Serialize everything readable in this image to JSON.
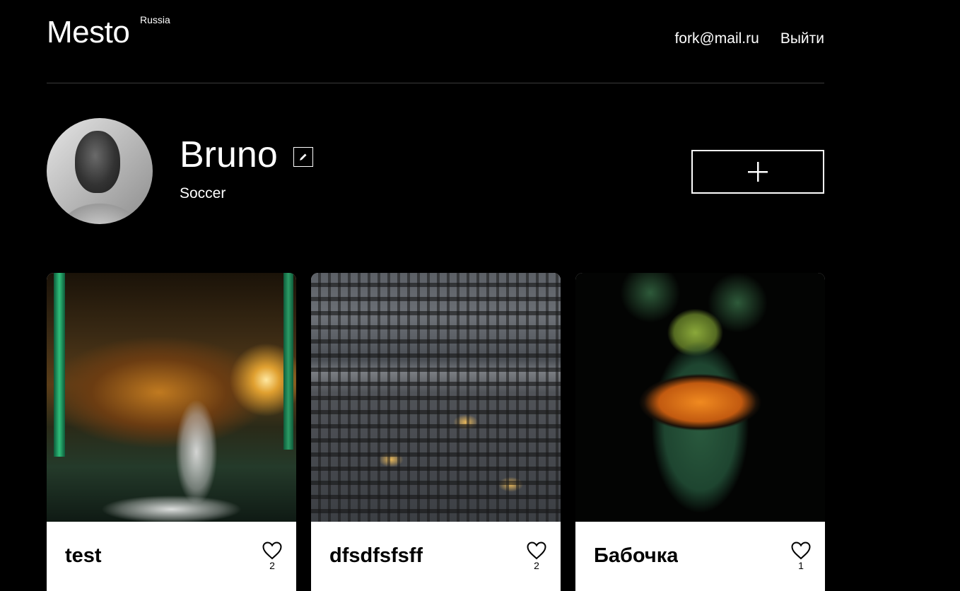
{
  "header": {
    "logo": "Mesto",
    "logo_sub": "Russia",
    "email": "fork@mail.ru",
    "logout_label": "Выйти"
  },
  "profile": {
    "name": "Bruno",
    "about": "Soccer",
    "edit_icon": "pencil-icon",
    "add_icon": "plus-icon"
  },
  "cards": [
    {
      "title": "test",
      "likes": "2",
      "image": "dancer under bridge with light trails"
    },
    {
      "title": "dfsdfsfsff",
      "likes": "2",
      "image": "city apartment blocks at dusk"
    },
    {
      "title": "Бабочка",
      "likes": "1",
      "image": "orange monarch butterfly on leaf"
    }
  ],
  "colors": {
    "background": "#000000",
    "text": "#ffffff",
    "card_bg": "#ffffff",
    "card_text": "#000000"
  }
}
